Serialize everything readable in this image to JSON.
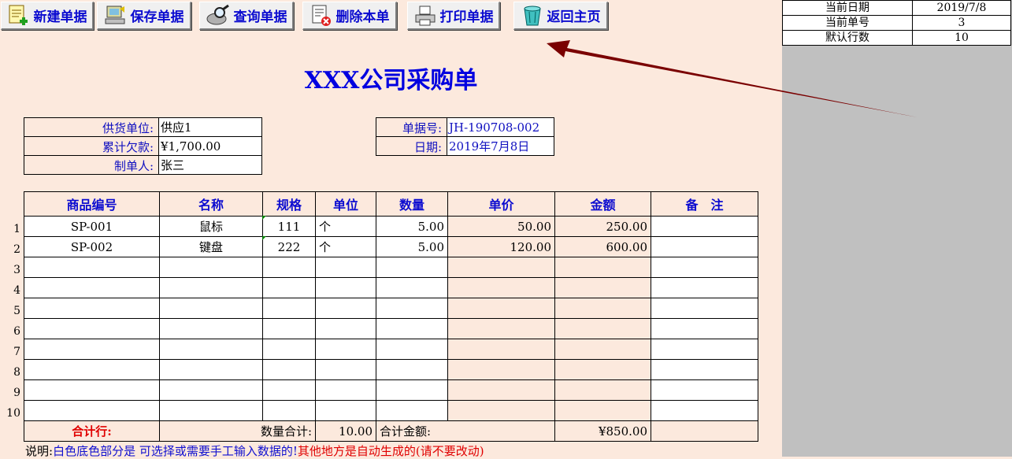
{
  "toolbar": {
    "buttons": [
      {
        "label": "新建单据",
        "icon": "new-document-icon"
      },
      {
        "label": "保存单据",
        "icon": "save-computer-icon"
      },
      {
        "label": "查询单据",
        "icon": "search-magnifier-icon"
      },
      {
        "label": "删除本单",
        "icon": "delete-document-icon"
      },
      {
        "label": "打印单据",
        "icon": "printer-icon"
      },
      {
        "label": "返回主页",
        "icon": "recycle-bin-icon"
      }
    ]
  },
  "info": {
    "rows": [
      {
        "key": "当前日期",
        "value": "2019/7/8"
      },
      {
        "key": "当前单号",
        "value": "3"
      },
      {
        "key": "默认行数",
        "value": "10"
      }
    ]
  },
  "title": "XXX公司采购单",
  "header_left": [
    {
      "label": "供货单位:",
      "value": "供应1"
    },
    {
      "label": "累计欠款:",
      "value": "¥1,700.00"
    },
    {
      "label": "制单人:",
      "value": "张三"
    }
  ],
  "header_right": [
    {
      "label": "单据号:",
      "value": "JH-190708-002"
    },
    {
      "label": "日期:",
      "value": "2019年7月8日"
    }
  ],
  "table": {
    "columns": [
      "商品编号",
      "名称",
      "规格",
      "单位",
      "数量",
      "单价",
      "金额",
      "备　注"
    ],
    "row_numbers": [
      "1",
      "2",
      "3",
      "4",
      "5",
      "6",
      "7",
      "8",
      "9",
      "10"
    ],
    "rows": [
      [
        "SP-001",
        "鼠标",
        "111",
        "个",
        "5.00",
        "50.00",
        "250.00",
        ""
      ],
      [
        "SP-002",
        "键盘",
        "222",
        "个",
        "5.00",
        "120.00",
        "600.00",
        ""
      ],
      [
        "",
        "",
        "",
        "",
        "",
        "",
        "",
        ""
      ],
      [
        "",
        "",
        "",
        "",
        "",
        "",
        "",
        ""
      ],
      [
        "",
        "",
        "",
        "",
        "",
        "",
        "",
        ""
      ],
      [
        "",
        "",
        "",
        "",
        "",
        "",
        "",
        ""
      ],
      [
        "",
        "",
        "",
        "",
        "",
        "",
        "",
        ""
      ],
      [
        "",
        "",
        "",
        "",
        "",
        "",
        "",
        ""
      ],
      [
        "",
        "",
        "",
        "",
        "",
        "",
        "",
        ""
      ],
      [
        "",
        "",
        "",
        "",
        "",
        "",
        "",
        ""
      ]
    ],
    "total": {
      "label": "合计行:",
      "qty_label": "数量合计:",
      "qty_value": "10.00",
      "amount_label": "合计金额:",
      "amount_value": "¥850.00"
    }
  },
  "note": {
    "prefix": "说明:",
    "blue": "白色底色部分是 可选择或需要手工输入数据的!",
    "red": "其他地方是自动生成的(请不要改动)"
  },
  "colors": {
    "accent": "#0b0bd0",
    "background": "#fce9dd",
    "arrow": "#7a0000",
    "side": "#c0c0c0"
  }
}
